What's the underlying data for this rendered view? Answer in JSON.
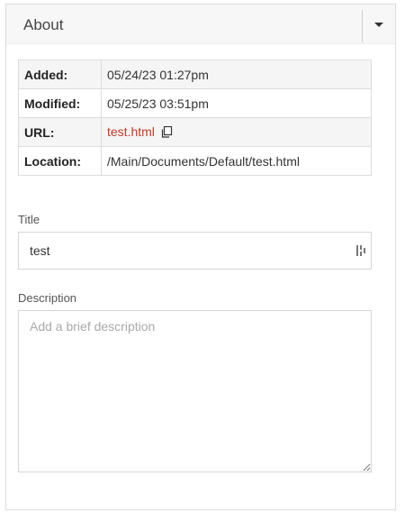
{
  "panel": {
    "title": "About",
    "toggle_icon": "caret-down-icon"
  },
  "metadata": {
    "rows": [
      {
        "label": "Added:",
        "value": "05/24/23 01:27pm"
      },
      {
        "label": "Modified:",
        "value": "05/25/23 03:51pm"
      },
      {
        "label": "URL:",
        "value": "test.html",
        "icon": "copy-icon"
      },
      {
        "label": "Location:",
        "value": "/Main/Documents/Default/test.html"
      }
    ]
  },
  "title_field": {
    "label": "Title",
    "value": "test",
    "icon": "tag-icon"
  },
  "description_field": {
    "label": "Description",
    "value": "",
    "placeholder": "Add a brief description"
  },
  "colors": {
    "link": "#c0392b",
    "header_bg": "#f7f7f7",
    "row_shade": "#f5f5f5",
    "border": "#dddddd"
  }
}
